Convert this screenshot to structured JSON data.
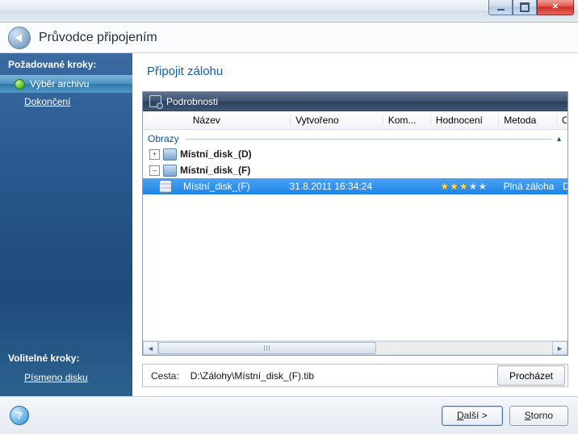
{
  "window": {
    "title": "Průvodce připojením"
  },
  "sidebar": {
    "required_title": "Požadované kroky:",
    "items": [
      {
        "label": "Výběr archivu",
        "active": true
      },
      {
        "label": "Dokončení",
        "link": true
      }
    ],
    "optional_title": "Volitelné kroky:",
    "optional_items": [
      {
        "label": "Písmeno disku",
        "link": true
      }
    ]
  },
  "main": {
    "page_title": "Připojit zálohu",
    "details_title": "Podrobnosti",
    "columns": {
      "name": "Název",
      "created": "Vytvořeno",
      "comment": "Kom...",
      "rating": "Hodnocení",
      "method": "Metoda",
      "path": "Cesta"
    },
    "group_label": "Obrazy",
    "tree": [
      {
        "label": "Místní_disk_(D)",
        "expanded": false
      },
      {
        "label": "Místní_disk_(F)",
        "expanded": true,
        "rows": [
          {
            "name": "Místní_disk_(F)",
            "created": "31.8.2011 16:34:24",
            "comment": "",
            "rating": 3,
            "method": "Plná záloha",
            "path": "D:\\Zálo"
          }
        ]
      }
    ],
    "path_label": "Cesta:",
    "path_value": "D:\\Zálohy\\Místní_disk_(F).tib",
    "browse_label": "Procházet"
  },
  "footer": {
    "next": "alší >",
    "next_access": "D",
    "cancel": "torno",
    "cancel_access": "S"
  }
}
